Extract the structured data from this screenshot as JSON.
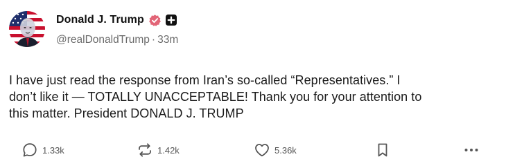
{
  "author": {
    "display_name": "Donald J. Trump",
    "handle": "@realDonaldTrump",
    "separator": "·",
    "time_ago": "33m"
  },
  "post": {
    "lines": [
      "I have just read the response from Iran’s so-called “Representatives.” I",
      "don’t like it — TOTALLY UNACCEPTABLE! Thank you for your attention to",
      "this matter. President DONALD J. TRUMP"
    ]
  },
  "actions": {
    "replies": "1.33k",
    "retruths": "1.42k",
    "likes": "5.36k"
  },
  "icons": {
    "verified": "verified-badge-icon",
    "plus": "plus-badge-icon",
    "reply": "speech-bubble-icon",
    "retruth": "repost-arrows-icon",
    "like": "heart-icon",
    "save": "bookmark-icon",
    "more": "ellipsis-icon"
  },
  "colors": {
    "verified_badge": "#e26577",
    "text": "#1a1a1a",
    "muted": "#6b6b6b"
  }
}
